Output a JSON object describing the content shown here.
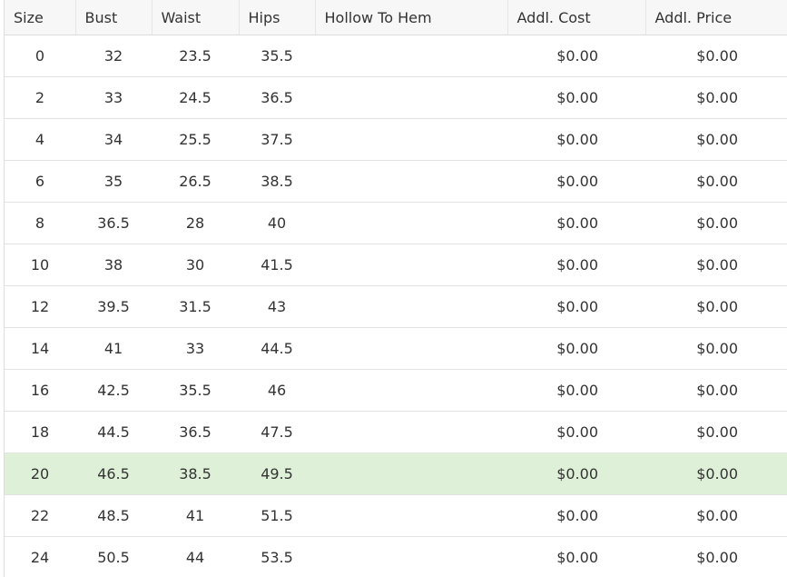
{
  "columns": {
    "size": "Size",
    "bust": "Bust",
    "waist": "Waist",
    "hips": "Hips",
    "hollow_to_hem": "Hollow To Hem",
    "addl_cost": "Addl. Cost",
    "addl_price": "Addl. Price"
  },
  "selected_row_index": 10,
  "highlight_color": "#dff0d8",
  "rows": [
    {
      "size": "0",
      "bust": "32",
      "waist": "23.5",
      "hips": "35.5",
      "hollow_to_hem": "",
      "addl_cost": "$0.00",
      "addl_price": "$0.00"
    },
    {
      "size": "2",
      "bust": "33",
      "waist": "24.5",
      "hips": "36.5",
      "hollow_to_hem": "",
      "addl_cost": "$0.00",
      "addl_price": "$0.00"
    },
    {
      "size": "4",
      "bust": "34",
      "waist": "25.5",
      "hips": "37.5",
      "hollow_to_hem": "",
      "addl_cost": "$0.00",
      "addl_price": "$0.00"
    },
    {
      "size": "6",
      "bust": "35",
      "waist": "26.5",
      "hips": "38.5",
      "hollow_to_hem": "",
      "addl_cost": "$0.00",
      "addl_price": "$0.00"
    },
    {
      "size": "8",
      "bust": "36.5",
      "waist": "28",
      "hips": "40",
      "hollow_to_hem": "",
      "addl_cost": "$0.00",
      "addl_price": "$0.00"
    },
    {
      "size": "10",
      "bust": "38",
      "waist": "30",
      "hips": "41.5",
      "hollow_to_hem": "",
      "addl_cost": "$0.00",
      "addl_price": "$0.00"
    },
    {
      "size": "12",
      "bust": "39.5",
      "waist": "31.5",
      "hips": "43",
      "hollow_to_hem": "",
      "addl_cost": "$0.00",
      "addl_price": "$0.00"
    },
    {
      "size": "14",
      "bust": "41",
      "waist": "33",
      "hips": "44.5",
      "hollow_to_hem": "",
      "addl_cost": "$0.00",
      "addl_price": "$0.00"
    },
    {
      "size": "16",
      "bust": "42.5",
      "waist": "35.5",
      "hips": "46",
      "hollow_to_hem": "",
      "addl_cost": "$0.00",
      "addl_price": "$0.00"
    },
    {
      "size": "18",
      "bust": "44.5",
      "waist": "36.5",
      "hips": "47.5",
      "hollow_to_hem": "",
      "addl_cost": "$0.00",
      "addl_price": "$0.00"
    },
    {
      "size": "20",
      "bust": "46.5",
      "waist": "38.5",
      "hips": "49.5",
      "hollow_to_hem": "",
      "addl_cost": "$0.00",
      "addl_price": "$0.00"
    },
    {
      "size": "22",
      "bust": "48.5",
      "waist": "41",
      "hips": "51.5",
      "hollow_to_hem": "",
      "addl_cost": "$0.00",
      "addl_price": "$0.00"
    },
    {
      "size": "24",
      "bust": "50.5",
      "waist": "44",
      "hips": "53.5",
      "hollow_to_hem": "",
      "addl_cost": "$0.00",
      "addl_price": "$0.00"
    }
  ]
}
